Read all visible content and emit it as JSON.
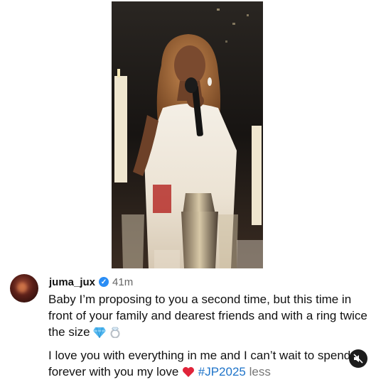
{
  "post": {
    "username": "juma_jux",
    "time_ago": "41m",
    "caption_line1": "Baby I’m proposing to you a second time, but this time in front of your family and dearest friends and with a ring twice the size",
    "caption_line2_text": "I love you with everything in me and I can’t wait to spend forever with you my love",
    "hashtag": "#JP2025",
    "less_label": "less"
  },
  "icons": {
    "verified": "verified-badge-icon",
    "gem": "gem-icon",
    "ring": "ring-icon",
    "heart": "red-heart-icon",
    "mute": "speaker-muted-icon"
  },
  "colors": {
    "hashtag": "#1d73c9",
    "verified": "#2a8df5",
    "heart": "#e0243a"
  }
}
